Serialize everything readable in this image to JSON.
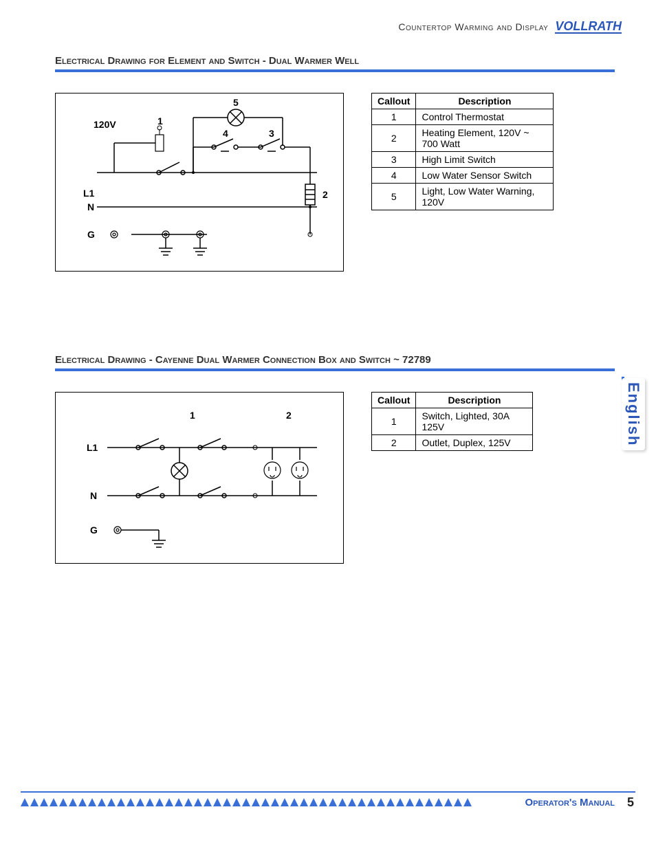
{
  "header": {
    "category": "Countertop Warming and Display",
    "brand": "VOLLRATH"
  },
  "section1": {
    "heading": "Electrical Drawing for Element and Switch - Dual Warmer Well",
    "diagram": {
      "voltage_label": "120V",
      "lines": {
        "l1": "L1",
        "n": "N",
        "g": "G"
      },
      "callouts": {
        "c1": "1",
        "c2": "2",
        "c3": "3",
        "c4": "4",
        "c5": "5"
      }
    },
    "table": {
      "head_callout": "Callout",
      "head_desc": "Description",
      "rows": [
        {
          "n": "1",
          "d": "Control Thermostat"
        },
        {
          "n": "2",
          "d": "Heating Element, 120V ~ 700 Watt"
        },
        {
          "n": "3",
          "d": "High Limit Switch"
        },
        {
          "n": "4",
          "d": "Low Water Sensor Switch"
        },
        {
          "n": "5",
          "d": "Light, Low Water Warning, 120V"
        }
      ]
    }
  },
  "section2": {
    "heading": "Electrical Drawing - Cayenne Dual Warmer Connection Box and Switch ~ 72789",
    "diagram": {
      "lines": {
        "l1": "L1",
        "n": "N",
        "g": "G"
      },
      "callouts": {
        "c1": "1",
        "c2": "2"
      }
    },
    "table": {
      "head_callout": "Callout",
      "head_desc": "Description",
      "rows": [
        {
          "n": "1",
          "d": "Switch, Lighted, 30A 125V"
        },
        {
          "n": "2",
          "d": "Outlet, Duplex, 125V"
        }
      ]
    }
  },
  "side_tab": "English",
  "footer": {
    "label": "Operator's Manual",
    "page": "5"
  }
}
